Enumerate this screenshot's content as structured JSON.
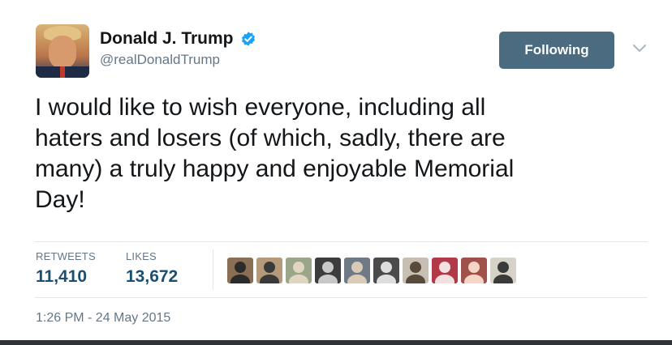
{
  "author": {
    "display_name": "Donald J. Trump",
    "handle": "@realDonaldTrump",
    "verified": true,
    "verified_color": "#1da1f2"
  },
  "follow_button": {
    "label": "Following",
    "color": "#4a6b80"
  },
  "tweet": {
    "text": "I would like to wish everyone, including all\nhaters and losers (of which, sadly, there are\nmany) a truly happy and enjoyable Memorial\nDay!"
  },
  "stats": {
    "retweets_label": "RETWEETS",
    "retweets_value": "11,410",
    "likes_label": "LIKES",
    "likes_value": "13,672",
    "value_color": "#1b4f72"
  },
  "likers": [
    {
      "icon": "liker-avatar-1",
      "bg": "#8a6f55",
      "fg": "#2b2b2b"
    },
    {
      "icon": "liker-avatar-2",
      "bg": "#b59a7a",
      "fg": "#3a3a3a"
    },
    {
      "icon": "liker-avatar-3",
      "bg": "#9aa58a",
      "fg": "#e0d6c0"
    },
    {
      "icon": "liker-avatar-4",
      "bg": "#3c3c3c",
      "fg": "#c8c8c8"
    },
    {
      "icon": "liker-avatar-5",
      "bg": "#6e7a86",
      "fg": "#d9cbb5"
    },
    {
      "icon": "liker-avatar-6",
      "bg": "#4a4a4a",
      "fg": "#dddddd"
    },
    {
      "icon": "liker-avatar-7",
      "bg": "#c7bfb4",
      "fg": "#5a4a3a"
    },
    {
      "icon": "liker-avatar-8",
      "bg": "#b23a48",
      "fg": "#f3e0e0"
    },
    {
      "icon": "liker-avatar-9",
      "bg": "#a0524a",
      "fg": "#f5d5c5"
    },
    {
      "icon": "liker-avatar-10",
      "bg": "#d7d2c8",
      "fg": "#3b3b3b"
    }
  ],
  "timestamp": "1:26 PM - 24 May 2015"
}
